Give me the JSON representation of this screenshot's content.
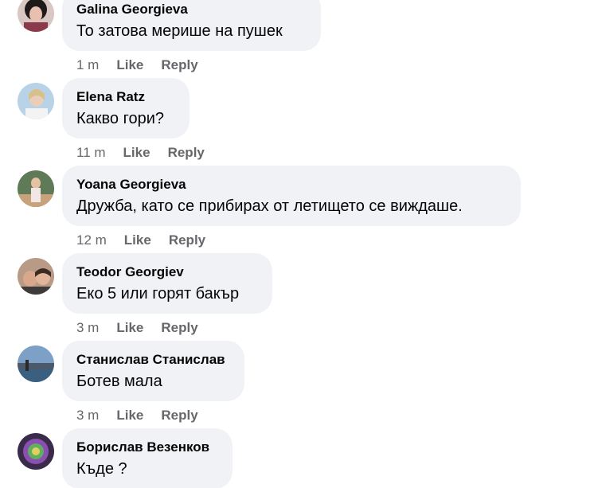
{
  "comments": [
    {
      "author": "Galina Georgieva",
      "text": "То затова мерише на пушек",
      "time": "1 m",
      "like": "Like",
      "reply": "Reply"
    },
    {
      "author": "Elena Ratz",
      "text": "Какво гори?",
      "time": "11 m",
      "like": "Like",
      "reply": "Reply"
    },
    {
      "author": "Yoana Georgieva",
      "text": "Дружба, като се прибирах от летището се виждаше.",
      "time": "12 m",
      "like": "Like",
      "reply": "Reply"
    },
    {
      "author": "Teodor Georgiev",
      "text": "Еко 5 или горят бакър",
      "time": "3 m",
      "like": "Like",
      "reply": "Reply"
    },
    {
      "author": "Станислав Станислав",
      "text": "Ботев мала",
      "time": "3 m",
      "like": "Like",
      "reply": "Reply"
    },
    {
      "author": "Борислав Везенков",
      "text": "Къде ?",
      "time": "",
      "like": "",
      "reply": ""
    }
  ],
  "colors": {
    "bubble": "#f0f2f5",
    "text": "#050505",
    "meta": "#65676b"
  }
}
